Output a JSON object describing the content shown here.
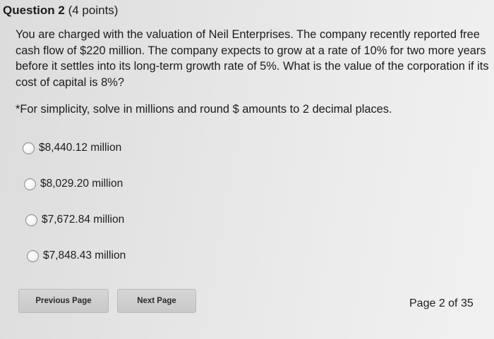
{
  "question": {
    "number_label": "Question 2",
    "points_label": "(4 points)",
    "body": "You are charged with the valuation of Neil Enterprises. The company recently reported free cash flow of $220 million. The company expects to grow at a rate of 10% for two more years before it settles into its long-term growth rate of 5%. What is the value of the corporation if its cost of capital is 8%?",
    "note": "*For simplicity, solve in millions and round $ amounts to 2 decimal places."
  },
  "options": [
    {
      "label": "$8,440.12 million",
      "selected": false
    },
    {
      "label": "$8,029.20 million",
      "selected": false
    },
    {
      "label": "$7,672.84 million",
      "selected": false
    },
    {
      "label": "$7,848.43 million",
      "selected": false
    }
  ],
  "navigation": {
    "previous_label": "Previous Page",
    "next_label": "Next Page",
    "page_indicator": "Page 2 of 35"
  }
}
